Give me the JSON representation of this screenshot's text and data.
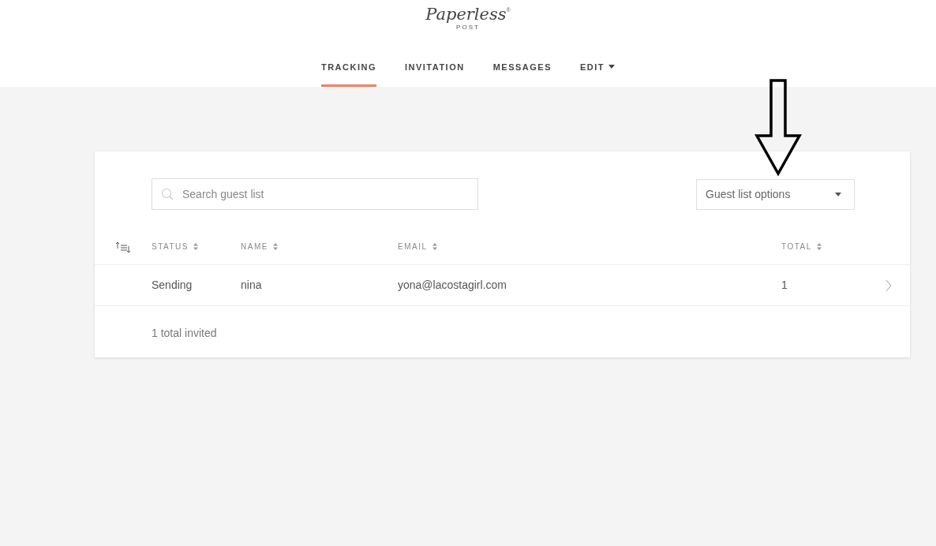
{
  "logo": {
    "script": "Paperless",
    "registered": "®",
    "subtitle": "POST"
  },
  "tabs": [
    {
      "label": "TRACKING",
      "selected": true,
      "dropdown": false
    },
    {
      "label": "INVITATION",
      "selected": false,
      "dropdown": false
    },
    {
      "label": "MESSAGES",
      "selected": false,
      "dropdown": false
    },
    {
      "label": "EDIT",
      "selected": false,
      "dropdown": true
    }
  ],
  "search": {
    "placeholder": "Search guest list"
  },
  "options_button": {
    "label": "Guest list options"
  },
  "table": {
    "columns": [
      {
        "label": "STATUS",
        "sortable": true
      },
      {
        "label": "NAME",
        "sortable": true
      },
      {
        "label": "EMAIL",
        "sortable": true
      },
      {
        "label": "TOTAL",
        "sortable": true
      }
    ],
    "rows": [
      {
        "cells": [
          "Sending",
          "nina",
          "yona@lacostagirl.com",
          "1"
        ]
      }
    ],
    "footer": "1 total invited"
  },
  "annotation": {
    "kind": "arrow"
  }
}
